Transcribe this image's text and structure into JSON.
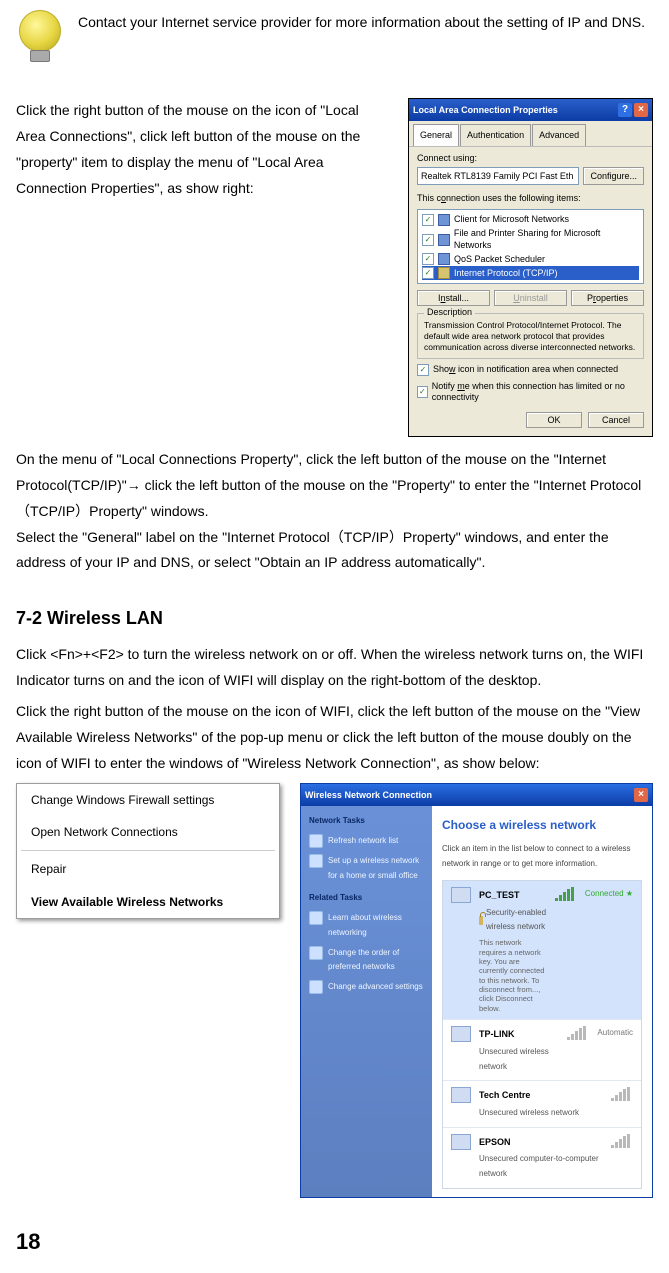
{
  "tip_text": "Contact your Internet service provider for more information about the setting of IP and DNS.",
  "para_right": "Click the right button of the mouse on the icon of \"Local Area Connections\", click left button of the mouse on the \"property\" item to display the menu of \"Local Area Connection Properties\", as show right:",
  "para_after1": "On the menu of \"Local Connections Property\", click the left button of the mouse on the \"Internet Protocol(TCP/IP)\"→ click the left button of the mouse on the \"Property\" to enter the \"Internet Protocol（TCP/IP）Property\" windows.",
  "para_after2": "Select the \"General\" label on the \"Internet Protocol（TCP/IP）Property\" windows, and enter the address of your IP and DNS, or select \"Obtain an IP address automatically\".",
  "heading": "7-2 Wireless LAN",
  "para_wlan1": "Click <Fn>+<F2> to turn the wireless network on or off. When the wireless network turns on, the WIFI Indicator turns on and the icon of WIFI will display on the right-bottom of the desktop.",
  "para_wlan2": "Click the right button of the mouse on the icon of WIFI, click the left button of the mouse on the \"View Available Wireless Networks\" of the pop-up menu or click the left button of the mouse doubly on the icon of WIFI to enter the windows of \"Wireless Network Connection\", as show below:",
  "page_number": "18",
  "lanwin": {
    "title": "Local Area Connection Properties",
    "tabs": [
      "General",
      "Authentication",
      "Advanced"
    ],
    "connect_using_label": "Connect using:",
    "adapter": "Realtek RTL8139 Family PCI Fast Eth",
    "configure": "Configure...",
    "items_label": "This connection uses the following items:",
    "items": [
      {
        "label": "Client for Microsoft Networks",
        "icon": "b"
      },
      {
        "label": "File and Printer Sharing for Microsoft Networks",
        "icon": "b"
      },
      {
        "label": "QoS Packet Scheduler",
        "icon": "b"
      },
      {
        "label": "Internet Protocol (TCP/IP)",
        "icon": "y",
        "sel": true
      }
    ],
    "install": "Install...",
    "uninstall": "Uninstall",
    "properties": "Properties",
    "desc_title": "Description",
    "desc_body": "Transmission Control Protocol/Internet Protocol. The default wide area network protocol that provides communication across diverse interconnected networks.",
    "show_icon": "Show icon in notification area when connected",
    "notify": "Notify me when this connection has limited or no connectivity",
    "ok": "OK",
    "cancel": "Cancel"
  },
  "ctx": {
    "items": [
      "Change Windows Firewall settings",
      "Open Network Connections",
      "Repair",
      "View Available Wireless Networks"
    ]
  },
  "wwin": {
    "title": "Wireless Network Connection",
    "tasks_head1": "Network Tasks",
    "task1": "Refresh network list",
    "task2": "Set up a wireless network for a home or small office",
    "tasks_head2": "Related Tasks",
    "task3": "Learn about wireless networking",
    "task4": "Change the order of preferred networks",
    "task5": "Change advanced settings",
    "main_title": "Choose a wireless network",
    "main_sub": "Click an item in the list below to connect to a wireless network in range or to get more information.",
    "nets": [
      {
        "name": "PC_TEST",
        "sec": "Security-enabled wireless network",
        "desc": "This network requires a network key. You are currently connected to this network. To disconnect from..., click Disconnect below.",
        "status": "Connected ★",
        "locked": true,
        "sel": true
      },
      {
        "name": "TP-LINK",
        "sec": "Unsecured wireless network",
        "status": "Automatic"
      },
      {
        "name": "Tech Centre",
        "sec": "Unsecured wireless network"
      },
      {
        "name": "EPSON",
        "sec": "Unsecured computer-to-computer network"
      }
    ]
  }
}
